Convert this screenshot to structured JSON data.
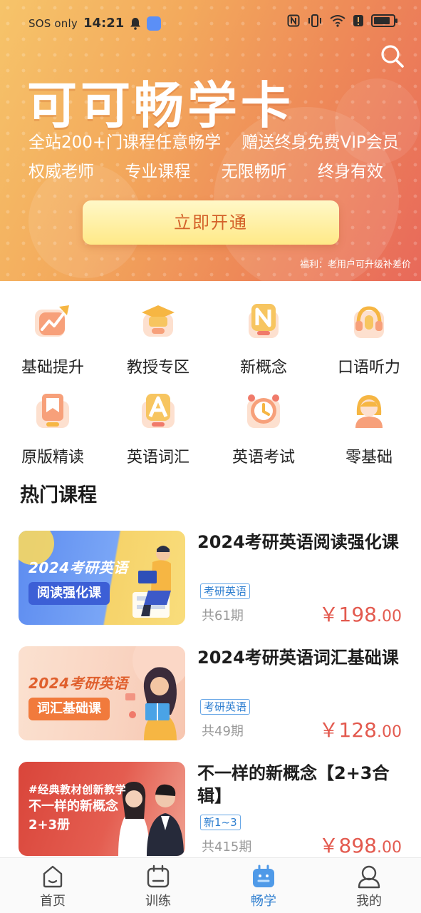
{
  "status_bar": {
    "carrier": "SOS only",
    "time": "14:21"
  },
  "banner": {
    "title": "可可畅学卡",
    "subtitle_left": "全站200+门课程任意畅学",
    "subtitle_right": "赠送终身免费VIP会员",
    "features": [
      "权威老师",
      "专业课程",
      "无限畅听",
      "终身有效"
    ],
    "cta_label": "立即开通",
    "welfare_note": "福利：老用户可升级补差价",
    "colors": {
      "gradient_start": "#f6c46a",
      "gradient_end": "#e8695a",
      "cta_text": "#d4622a"
    }
  },
  "categories": [
    {
      "label": "基础提升",
      "icon": "trend-up-icon"
    },
    {
      "label": "教授专区",
      "icon": "graduation-cap-icon"
    },
    {
      "label": "新概念",
      "icon": "letter-n-icon"
    },
    {
      "label": "口语听力",
      "icon": "headset-icon"
    },
    {
      "label": "原版精读",
      "icon": "bookmark-icon"
    },
    {
      "label": "英语词汇",
      "icon": "letter-a-icon"
    },
    {
      "label": "英语考试",
      "icon": "clock-icon"
    },
    {
      "label": "零基础",
      "icon": "girl-avatar-icon"
    }
  ],
  "hot_courses": {
    "title": "热门课程",
    "items": [
      {
        "title": "2024考研英语阅读强化课",
        "badge": "考研英语",
        "count": "共61期",
        "price_symbol": "￥",
        "price_int": "198",
        "price_dec": ".00",
        "thumb_headline": "2024考研英语",
        "thumb_tag": "阅读强化课"
      },
      {
        "title": "2024考研英语词汇基础课",
        "badge": "考研英语",
        "count": "共49期",
        "price_symbol": "￥",
        "price_int": "128",
        "price_dec": ".00",
        "thumb_headline": "2024考研英语",
        "thumb_tag": "词汇基础课"
      },
      {
        "title": "不一样的新概念【2+3合辑】",
        "badge": "新1~3",
        "count": "共415期",
        "price_symbol": "￥",
        "price_int": "898",
        "price_dec": ".00",
        "thumb_headline": "#经典教材创新教学",
        "thumb_tag": "不一样的新概念2+3册"
      }
    ]
  },
  "tab_bar": {
    "tabs": [
      {
        "label": "首页",
        "icon": "home-icon",
        "active": false
      },
      {
        "label": "训练",
        "icon": "training-icon",
        "active": false
      },
      {
        "label": "畅学",
        "icon": "changxue-icon",
        "active": true
      },
      {
        "label": "我的",
        "icon": "profile-icon",
        "active": false
      }
    ],
    "active_color": "#2f7fd0"
  }
}
